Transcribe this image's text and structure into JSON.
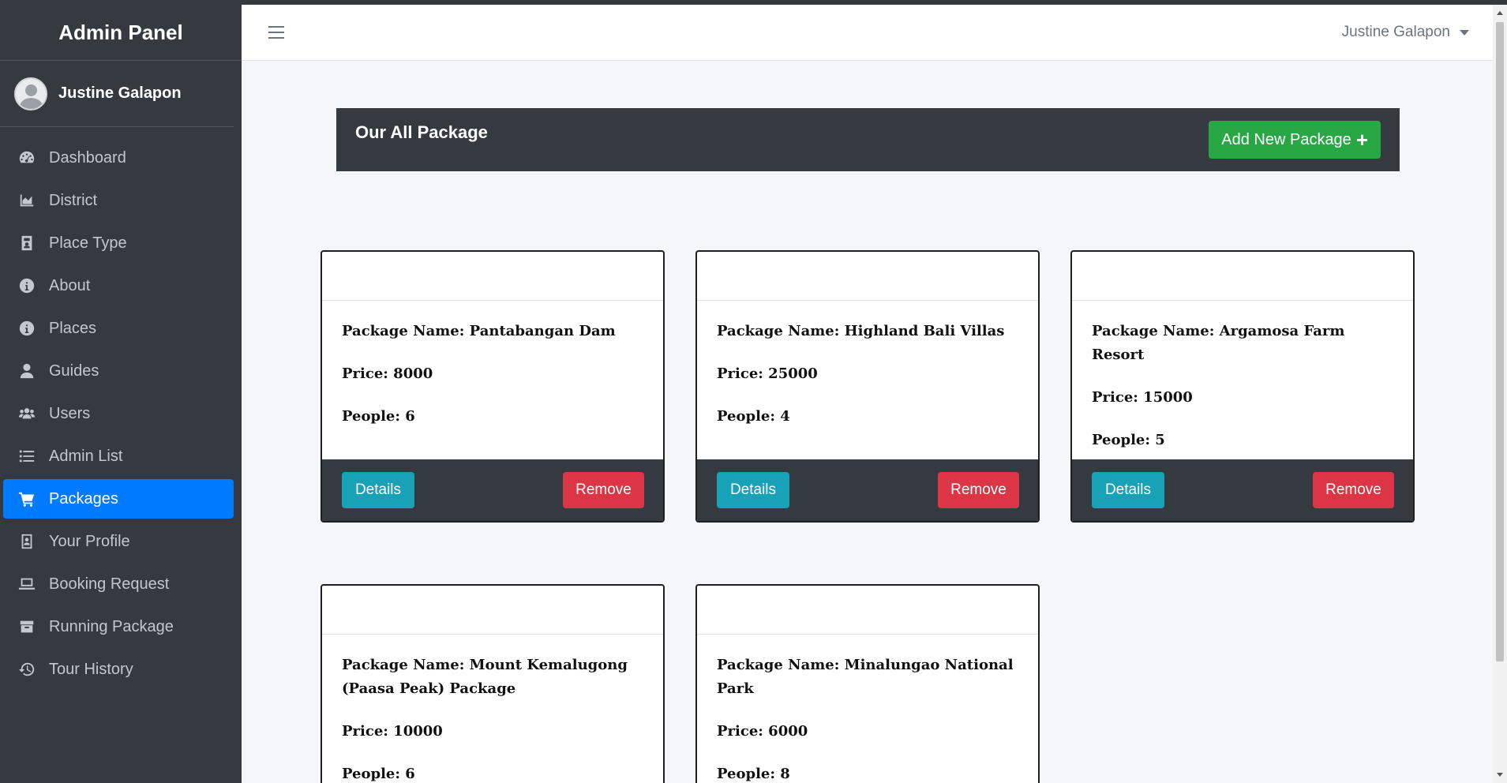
{
  "brand": {
    "title": "Admin Panel"
  },
  "user": {
    "name": "Justine Galapon"
  },
  "sidebar": {
    "items": [
      {
        "label": "Dashboard",
        "icon": "tachometer-icon"
      },
      {
        "label": "District",
        "icon": "area-chart-icon"
      },
      {
        "label": "Place Type",
        "icon": "id-card-icon"
      },
      {
        "label": "About",
        "icon": "info-circle-icon"
      },
      {
        "label": "Places",
        "icon": "info-circle-icon"
      },
      {
        "label": "Guides",
        "icon": "user-icon"
      },
      {
        "label": "Users",
        "icon": "users-icon"
      },
      {
        "label": "Admin List",
        "icon": "list-icon"
      },
      {
        "label": "Packages",
        "icon": "shopping-cart-icon",
        "active": true
      },
      {
        "label": "Your Profile",
        "icon": "address-card-icon"
      },
      {
        "label": "Booking Request",
        "icon": "laptop-icon"
      },
      {
        "label": "Running Package",
        "icon": "box-icon"
      },
      {
        "label": "Tour History",
        "icon": "history-icon"
      }
    ]
  },
  "navbar": {
    "user_label": "Justine Galapon"
  },
  "header": {
    "title": "Our All Package",
    "add_button": "Add New Package"
  },
  "packages": [
    {
      "name_label": "Package Name: Pantabangan Dam",
      "price_label": "Price: 8000",
      "people_label": "People: 6"
    },
    {
      "name_label": "Package Name: Highland Bali Villas",
      "price_label": "Price: 25000",
      "people_label": "People: 4"
    },
    {
      "name_label": "Package Name: Argamosa Farm Resort",
      "price_label": "Price: 15000",
      "people_label": "People: 5"
    },
    {
      "name_label": "Package Name: Mount Kemalugong (Paasa Peak) Package",
      "price_label": "Price: 10000",
      "people_label": "People: 6"
    },
    {
      "name_label": "Package Name: Minalungao National Park",
      "price_label": "Price: 6000",
      "people_label": "People: 8"
    }
  ],
  "card_buttons": {
    "details": "Details",
    "remove": "Remove"
  },
  "colors": {
    "sidebar_bg": "#343a40",
    "active_item": "#007bff",
    "add_button": "#28a745",
    "details_button": "#17a2b8",
    "remove_button": "#dc3545",
    "content_bg": "#f4f6f9"
  }
}
